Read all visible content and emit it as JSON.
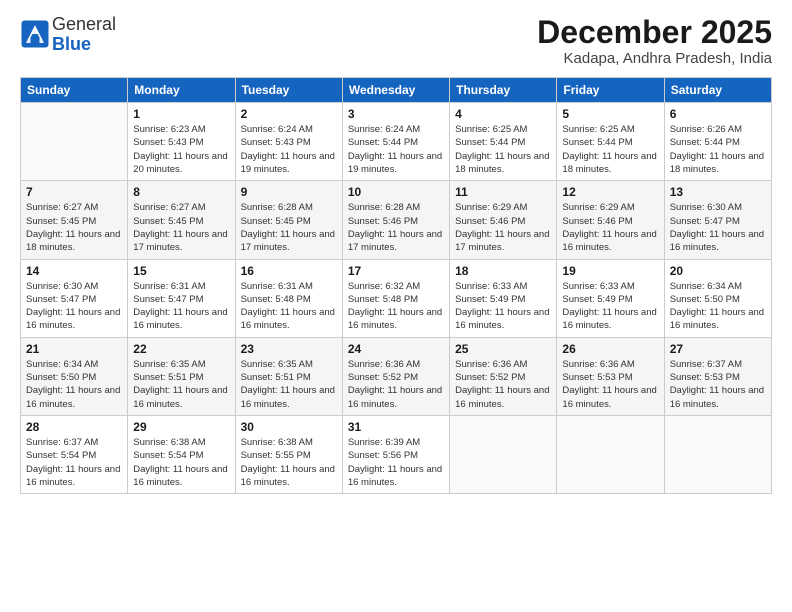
{
  "logo": {
    "general": "General",
    "blue": "Blue"
  },
  "title": "December 2025",
  "location": "Kadapa, Andhra Pradesh, India",
  "header_days": [
    "Sunday",
    "Monday",
    "Tuesday",
    "Wednesday",
    "Thursday",
    "Friday",
    "Saturday"
  ],
  "weeks": [
    [
      {
        "num": "",
        "sunrise": "",
        "sunset": "",
        "daylight": ""
      },
      {
        "num": "1",
        "sunrise": "Sunrise: 6:23 AM",
        "sunset": "Sunset: 5:43 PM",
        "daylight": "Daylight: 11 hours and 20 minutes."
      },
      {
        "num": "2",
        "sunrise": "Sunrise: 6:24 AM",
        "sunset": "Sunset: 5:43 PM",
        "daylight": "Daylight: 11 hours and 19 minutes."
      },
      {
        "num": "3",
        "sunrise": "Sunrise: 6:24 AM",
        "sunset": "Sunset: 5:44 PM",
        "daylight": "Daylight: 11 hours and 19 minutes."
      },
      {
        "num": "4",
        "sunrise": "Sunrise: 6:25 AM",
        "sunset": "Sunset: 5:44 PM",
        "daylight": "Daylight: 11 hours and 18 minutes."
      },
      {
        "num": "5",
        "sunrise": "Sunrise: 6:25 AM",
        "sunset": "Sunset: 5:44 PM",
        "daylight": "Daylight: 11 hours and 18 minutes."
      },
      {
        "num": "6",
        "sunrise": "Sunrise: 6:26 AM",
        "sunset": "Sunset: 5:44 PM",
        "daylight": "Daylight: 11 hours and 18 minutes."
      }
    ],
    [
      {
        "num": "7",
        "sunrise": "Sunrise: 6:27 AM",
        "sunset": "Sunset: 5:45 PM",
        "daylight": "Daylight: 11 hours and 18 minutes."
      },
      {
        "num": "8",
        "sunrise": "Sunrise: 6:27 AM",
        "sunset": "Sunset: 5:45 PM",
        "daylight": "Daylight: 11 hours and 17 minutes."
      },
      {
        "num": "9",
        "sunrise": "Sunrise: 6:28 AM",
        "sunset": "Sunset: 5:45 PM",
        "daylight": "Daylight: 11 hours and 17 minutes."
      },
      {
        "num": "10",
        "sunrise": "Sunrise: 6:28 AM",
        "sunset": "Sunset: 5:46 PM",
        "daylight": "Daylight: 11 hours and 17 minutes."
      },
      {
        "num": "11",
        "sunrise": "Sunrise: 6:29 AM",
        "sunset": "Sunset: 5:46 PM",
        "daylight": "Daylight: 11 hours and 17 minutes."
      },
      {
        "num": "12",
        "sunrise": "Sunrise: 6:29 AM",
        "sunset": "Sunset: 5:46 PM",
        "daylight": "Daylight: 11 hours and 16 minutes."
      },
      {
        "num": "13",
        "sunrise": "Sunrise: 6:30 AM",
        "sunset": "Sunset: 5:47 PM",
        "daylight": "Daylight: 11 hours and 16 minutes."
      }
    ],
    [
      {
        "num": "14",
        "sunrise": "Sunrise: 6:30 AM",
        "sunset": "Sunset: 5:47 PM",
        "daylight": "Daylight: 11 hours and 16 minutes."
      },
      {
        "num": "15",
        "sunrise": "Sunrise: 6:31 AM",
        "sunset": "Sunset: 5:47 PM",
        "daylight": "Daylight: 11 hours and 16 minutes."
      },
      {
        "num": "16",
        "sunrise": "Sunrise: 6:31 AM",
        "sunset": "Sunset: 5:48 PM",
        "daylight": "Daylight: 11 hours and 16 minutes."
      },
      {
        "num": "17",
        "sunrise": "Sunrise: 6:32 AM",
        "sunset": "Sunset: 5:48 PM",
        "daylight": "Daylight: 11 hours and 16 minutes."
      },
      {
        "num": "18",
        "sunrise": "Sunrise: 6:33 AM",
        "sunset": "Sunset: 5:49 PM",
        "daylight": "Daylight: 11 hours and 16 minutes."
      },
      {
        "num": "19",
        "sunrise": "Sunrise: 6:33 AM",
        "sunset": "Sunset: 5:49 PM",
        "daylight": "Daylight: 11 hours and 16 minutes."
      },
      {
        "num": "20",
        "sunrise": "Sunrise: 6:34 AM",
        "sunset": "Sunset: 5:50 PM",
        "daylight": "Daylight: 11 hours and 16 minutes."
      }
    ],
    [
      {
        "num": "21",
        "sunrise": "Sunrise: 6:34 AM",
        "sunset": "Sunset: 5:50 PM",
        "daylight": "Daylight: 11 hours and 16 minutes."
      },
      {
        "num": "22",
        "sunrise": "Sunrise: 6:35 AM",
        "sunset": "Sunset: 5:51 PM",
        "daylight": "Daylight: 11 hours and 16 minutes."
      },
      {
        "num": "23",
        "sunrise": "Sunrise: 6:35 AM",
        "sunset": "Sunset: 5:51 PM",
        "daylight": "Daylight: 11 hours and 16 minutes."
      },
      {
        "num": "24",
        "sunrise": "Sunrise: 6:36 AM",
        "sunset": "Sunset: 5:52 PM",
        "daylight": "Daylight: 11 hours and 16 minutes."
      },
      {
        "num": "25",
        "sunrise": "Sunrise: 6:36 AM",
        "sunset": "Sunset: 5:52 PM",
        "daylight": "Daylight: 11 hours and 16 minutes."
      },
      {
        "num": "26",
        "sunrise": "Sunrise: 6:36 AM",
        "sunset": "Sunset: 5:53 PM",
        "daylight": "Daylight: 11 hours and 16 minutes."
      },
      {
        "num": "27",
        "sunrise": "Sunrise: 6:37 AM",
        "sunset": "Sunset: 5:53 PM",
        "daylight": "Daylight: 11 hours and 16 minutes."
      }
    ],
    [
      {
        "num": "28",
        "sunrise": "Sunrise: 6:37 AM",
        "sunset": "Sunset: 5:54 PM",
        "daylight": "Daylight: 11 hours and 16 minutes."
      },
      {
        "num": "29",
        "sunrise": "Sunrise: 6:38 AM",
        "sunset": "Sunset: 5:54 PM",
        "daylight": "Daylight: 11 hours and 16 minutes."
      },
      {
        "num": "30",
        "sunrise": "Sunrise: 6:38 AM",
        "sunset": "Sunset: 5:55 PM",
        "daylight": "Daylight: 11 hours and 16 minutes."
      },
      {
        "num": "31",
        "sunrise": "Sunrise: 6:39 AM",
        "sunset": "Sunset: 5:56 PM",
        "daylight": "Daylight: 11 hours and 16 minutes."
      },
      {
        "num": "",
        "sunrise": "",
        "sunset": "",
        "daylight": ""
      },
      {
        "num": "",
        "sunrise": "",
        "sunset": "",
        "daylight": ""
      },
      {
        "num": "",
        "sunrise": "",
        "sunset": "",
        "daylight": ""
      }
    ]
  ]
}
